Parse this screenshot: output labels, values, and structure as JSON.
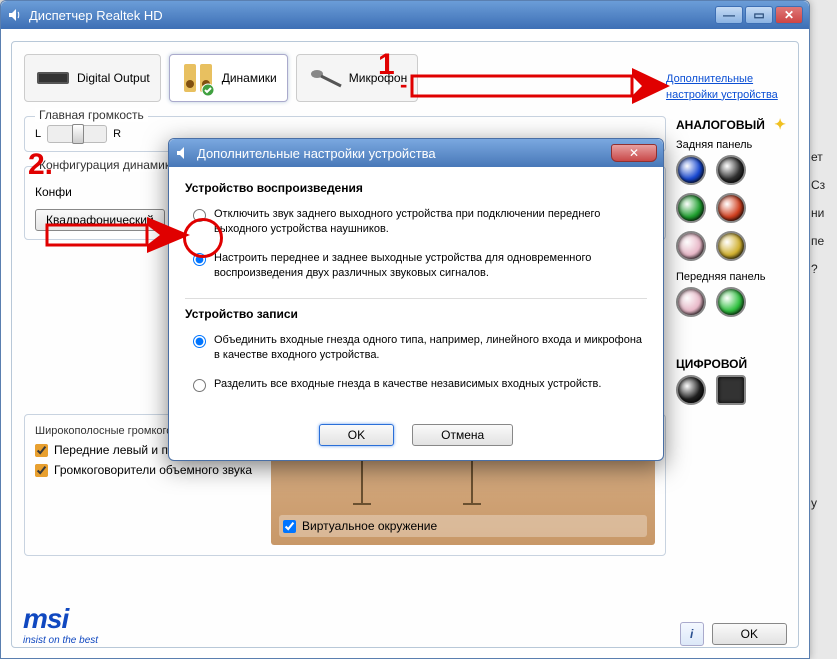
{
  "window": {
    "title": "Диспетчер Realtek HD"
  },
  "tabs": {
    "digital": "Digital Output",
    "speakers": "Динамики",
    "mic": "Микрофон"
  },
  "adv_link": "Дополнительные настройки устройства",
  "volume": {
    "group": "Главная громкость",
    "L": "L",
    "R": "R"
  },
  "config": {
    "group": "Конфигурация динамик",
    "label_partial": "Конфи",
    "dropdown": "Квадрафонический"
  },
  "speakers_box": {
    "group": "Широкополосные громкоговорители",
    "front": "Передние левый и правый",
    "surround": "Громкоговорители объемного звука",
    "virtual": "Виртуальное окружение"
  },
  "right": {
    "analog": "АНАЛОГОВЫЙ",
    "rear": "Задняя панель",
    "front": "Передняя панель",
    "digital": "ЦИФРОВОЙ",
    "jacks_rear": [
      "#1848d0",
      "#303030",
      "#20a030",
      "#d04020",
      "#e8b8c8",
      "#d0b030"
    ],
    "jacks_front": [
      "#e8b8c8",
      "#30c040"
    ]
  },
  "footer": {
    "logo": "msi",
    "slogan": "insist on the best",
    "ok": "OK"
  },
  "modal": {
    "title": "Дополнительные настройки устройства",
    "playback": {
      "heading": "Устройство воспроизведения",
      "opt1": "Отключить звук заднего выходного устройства при подключении переднего выходного устройства наушников.",
      "opt2": "Настроить переднее и заднее выходные устройства для одновременного воспроизведения двух различных звуковых сигналов."
    },
    "record": {
      "heading": "Устройство записи",
      "opt1": "Объединить входные гнезда одного типа, например, линейного входа и микрофона в качестве входного устройства.",
      "opt2": "Разделить все входные гнезда в качестве независимых входных устройств."
    },
    "ok": "OK",
    "cancel": "Отмена"
  },
  "annotations": {
    "one": "1",
    "two": "2.",
    "dash": "-"
  },
  "side_letters": [
    "ет",
    "Сз",
    "ни",
    "пе",
    "?",
    "у"
  ]
}
